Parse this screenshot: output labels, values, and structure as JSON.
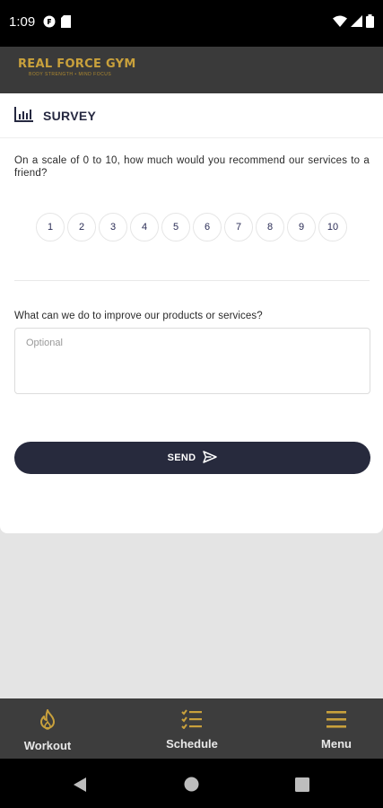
{
  "status_bar": {
    "time": "1:09"
  },
  "header": {
    "logo_text": "REAL FORCE GYM",
    "logo_tagline": "BODY STRENGTH • MIND FOCUS"
  },
  "survey": {
    "title": "SURVEY",
    "question1": "On a scale of 0 to 10, how much would you recommend our services to a friend?",
    "scale": [
      "1",
      "2",
      "3",
      "4",
      "5",
      "6",
      "7",
      "8",
      "9",
      "10"
    ],
    "question2": "What can we do to improve our products or services?",
    "feedback_placeholder": "Optional",
    "send_label": "SEND"
  },
  "bottom_nav": [
    {
      "label": "Workout",
      "icon": "flame-icon"
    },
    {
      "label": "Schedule",
      "icon": "checklist-icon"
    },
    {
      "label": "Menu",
      "icon": "hamburger-menu-icon"
    }
  ],
  "colors": {
    "accent": "#c9a13c",
    "primary_dark": "#272a3d",
    "header_bg": "#3a3a3a",
    "nav_bg": "#3d3d3d"
  }
}
